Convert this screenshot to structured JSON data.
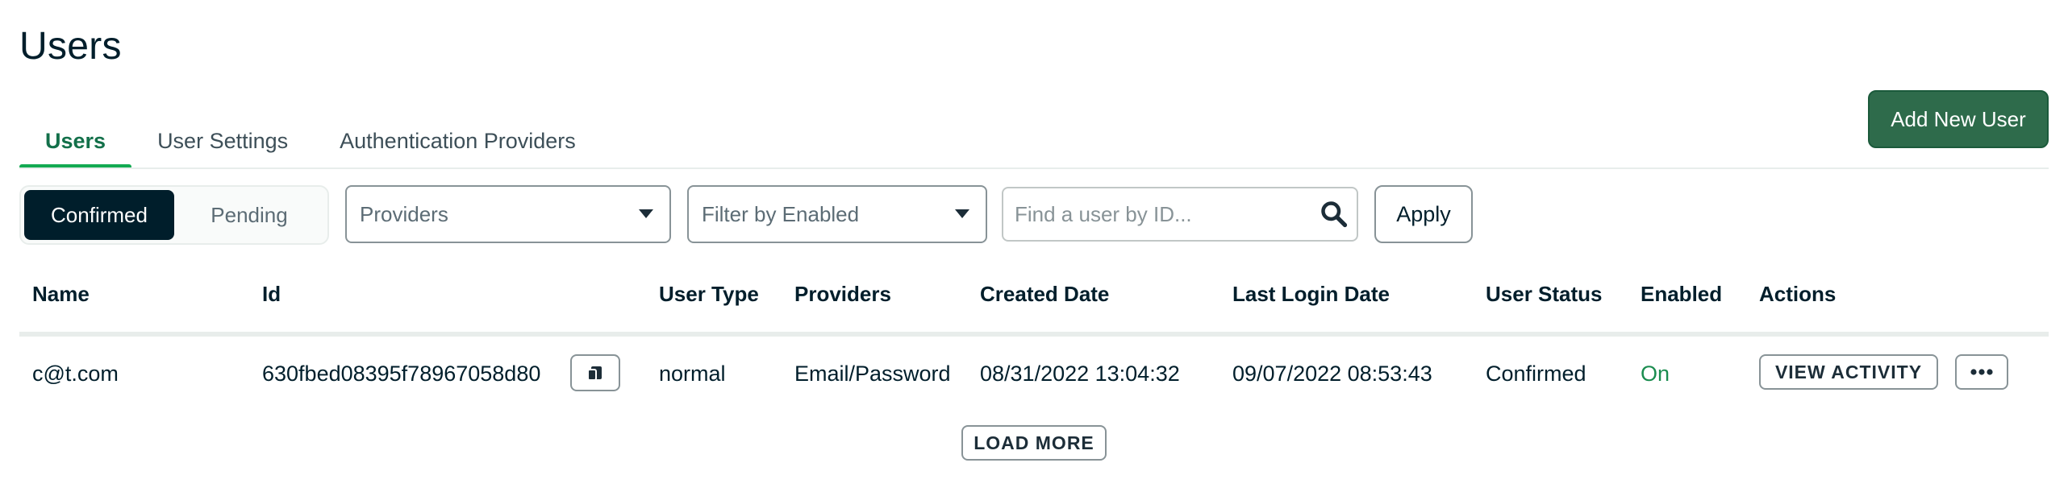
{
  "page": {
    "title": "Users"
  },
  "tabs": [
    {
      "label": "Users",
      "active": true
    },
    {
      "label": "User Settings",
      "active": false
    },
    {
      "label": "Authentication Providers",
      "active": false
    }
  ],
  "header": {
    "add_user_label": "Add New User"
  },
  "filters": {
    "status_toggle": [
      {
        "label": "Confirmed",
        "active": true
      },
      {
        "label": "Pending",
        "active": false
      }
    ],
    "providers_select": {
      "value": "Providers"
    },
    "enabled_select": {
      "value": "Filter by Enabled"
    },
    "search": {
      "placeholder": "Find a user by ID...",
      "value": ""
    },
    "apply_label": "Apply"
  },
  "table": {
    "columns": [
      "Name",
      "Id",
      "User Type",
      "Providers",
      "Created Date",
      "Last Login Date",
      "User Status",
      "Enabled",
      "Actions"
    ],
    "rows": [
      {
        "name": "c@t.com",
        "id": "630fbed08395f78967058d80",
        "user_type": "normal",
        "providers": "Email/Password",
        "created": "08/31/2022 13:04:32",
        "last_login": "09/07/2022 08:53:43",
        "status": "Confirmed",
        "enabled": "On",
        "view_activity_label": "VIEW ACTIVITY"
      }
    ],
    "load_more_label": "LOAD MORE"
  },
  "colors": {
    "primary_button": "#2e6b4b",
    "active_tab": "#13704a",
    "active_tab_underline": "#13aa52",
    "enabled_text": "#1a8c4f",
    "toggle_active": "#001e2b"
  },
  "icons": {
    "search": "search-icon",
    "copy": "copy-icon",
    "more": "ellipsis-icon",
    "dropdown": "caret-down-icon"
  }
}
